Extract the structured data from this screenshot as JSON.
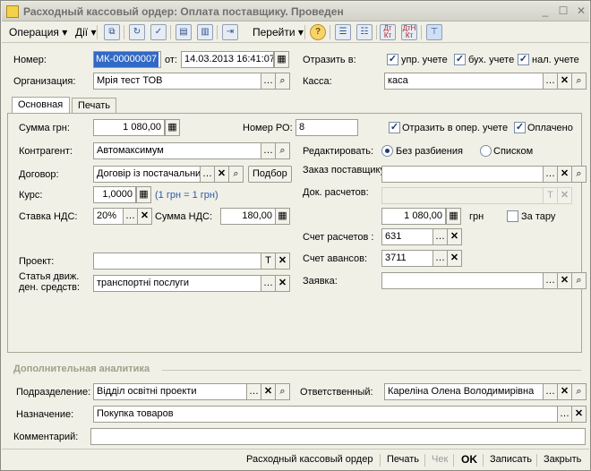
{
  "window": {
    "title": "Расходный кассовый ордер: Оплата поставщику. Проведен",
    "min": "_",
    "max": "☐",
    "close": "✕"
  },
  "toolbar": {
    "operation": "Операция ▾",
    "actions": "Дії ▾",
    "goto": "Перейти ▾",
    "help": "?",
    "dt_kt": "Дт Кт",
    "dtn_kt": "ДтН Кт"
  },
  "header": {
    "number_label": "Номер:",
    "number_value": "МК-00000007",
    "date_label": "от:",
    "date_value": "14.03.2013 16:41:07",
    "reflect_label": "Отразить в:",
    "upr_label": "упр. учете",
    "buh_label": "бух. учете",
    "nal_label": "нал. учете",
    "org_label": "Организация:",
    "org_value": "Мрія тест ТОВ",
    "kassa_label": "Касса:",
    "kassa_value": "каса"
  },
  "tabs": [
    {
      "label": "Основная"
    },
    {
      "label": "Печать"
    }
  ],
  "main": {
    "sum_label": "Сумма грн:",
    "sum_value": "1 080,00",
    "po_label": "Номер РО:",
    "po_value": "8",
    "oper_label": "Отразить в опер. учете",
    "paid_label": "Оплачено",
    "contr_label": "Контрагент:",
    "contr_value": "Автомаксимум",
    "edit_label": "Редактировать:",
    "no_split": "Без разбиения",
    "by_list": "Списком",
    "dog_label": "Договор:",
    "dog_value": "Договір із постачальником",
    "podbor": "Подбор",
    "order_label": "Заказ поставщику:",
    "doc_label": "Док. расчетов:",
    "rate_label": "Курс:",
    "rate_value": "1,0000",
    "rate_note": "(1 грн = 1 грн)",
    "vat_label": "Ставка НДС:",
    "vat_value": "20%",
    "vatsum_label": "Сумма НДС:",
    "vatsum_value": "180,00",
    "amount_value": "1 080,00",
    "currency": "грн",
    "tara_label": "За тару",
    "acc_label": "Счет расчетов :",
    "acc_value": "631",
    "adv_label": "Счет авансов:",
    "adv_value": "3711",
    "project_label": "Проект:",
    "claim_label": "Заявка:",
    "flow_label1": "Статья движ.",
    "flow_label2": "ден. средств:",
    "flow_value": "транспортні послуги"
  },
  "extra": {
    "section": "Дополнительная аналитика",
    "dept_label": "Подразделение:",
    "dept_value": "Відділ освітні проекти",
    "resp_label": "Ответственный:",
    "resp_value": "Кареліна Олена Володимирівна",
    "purpose_label": "Назначение:",
    "purpose_value": "Покупка товаров",
    "comment_label": "Комментарий:",
    "comment_value": ""
  },
  "footer": {
    "doc_print": "Расходный кассовый ордер",
    "print": "Печать",
    "check": "Чек",
    "ok": "OK",
    "save": "Записать",
    "close": "Закрыть"
  }
}
